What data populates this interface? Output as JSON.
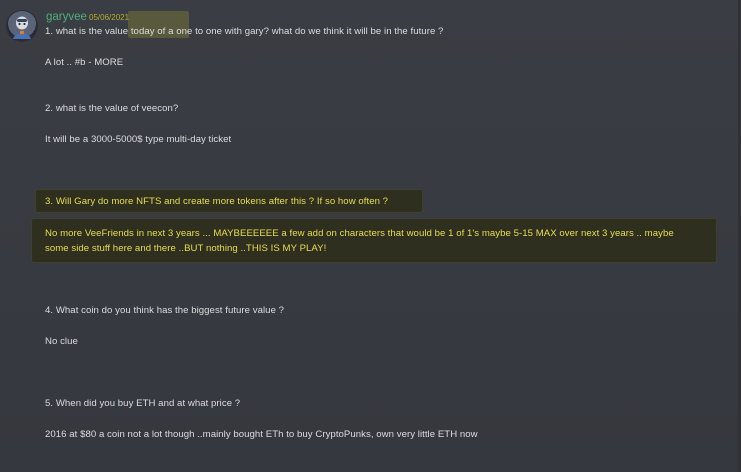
{
  "author": {
    "username": "garyvee",
    "timestamp": "05/06/2021",
    "avatar_icon": "avatar-icon"
  },
  "message_lines": [
    "1. what is the value today of a one to one with gary? what do we think it will be in the future ?",
    "A lot .. #b - MORE",
    "2. what is the value of veecon?",
    "It will be a 3000-5000$ type multi-day ticket",
    "3. Will Gary do more NFTS and create more tokens after this ? If so how often ?",
    "No more VeeFriends in next 3 years ... MAYBEEEEEE a few add on characters that would be 1 of 1's maybe 5-15 MAX over next 3 years .. maybe",
    "some side stuff here and there ..BUT nothing ..THIS IS MY PLAY!",
    "4. What coin do you think has the biggest future value ?",
    "No clue",
    "5. When did you buy ETH and at what price ?",
    "2016 at $80 a coin not a lot though ..mainly bought ETh to buy CryptoPunks, own very little ETH now"
  ],
  "colors": {
    "background": "#36393f",
    "username": "#4fae7a",
    "text": "#dcddde",
    "highlight_text": "#e7dd56",
    "highlight_bg": "#2f2f1f"
  }
}
